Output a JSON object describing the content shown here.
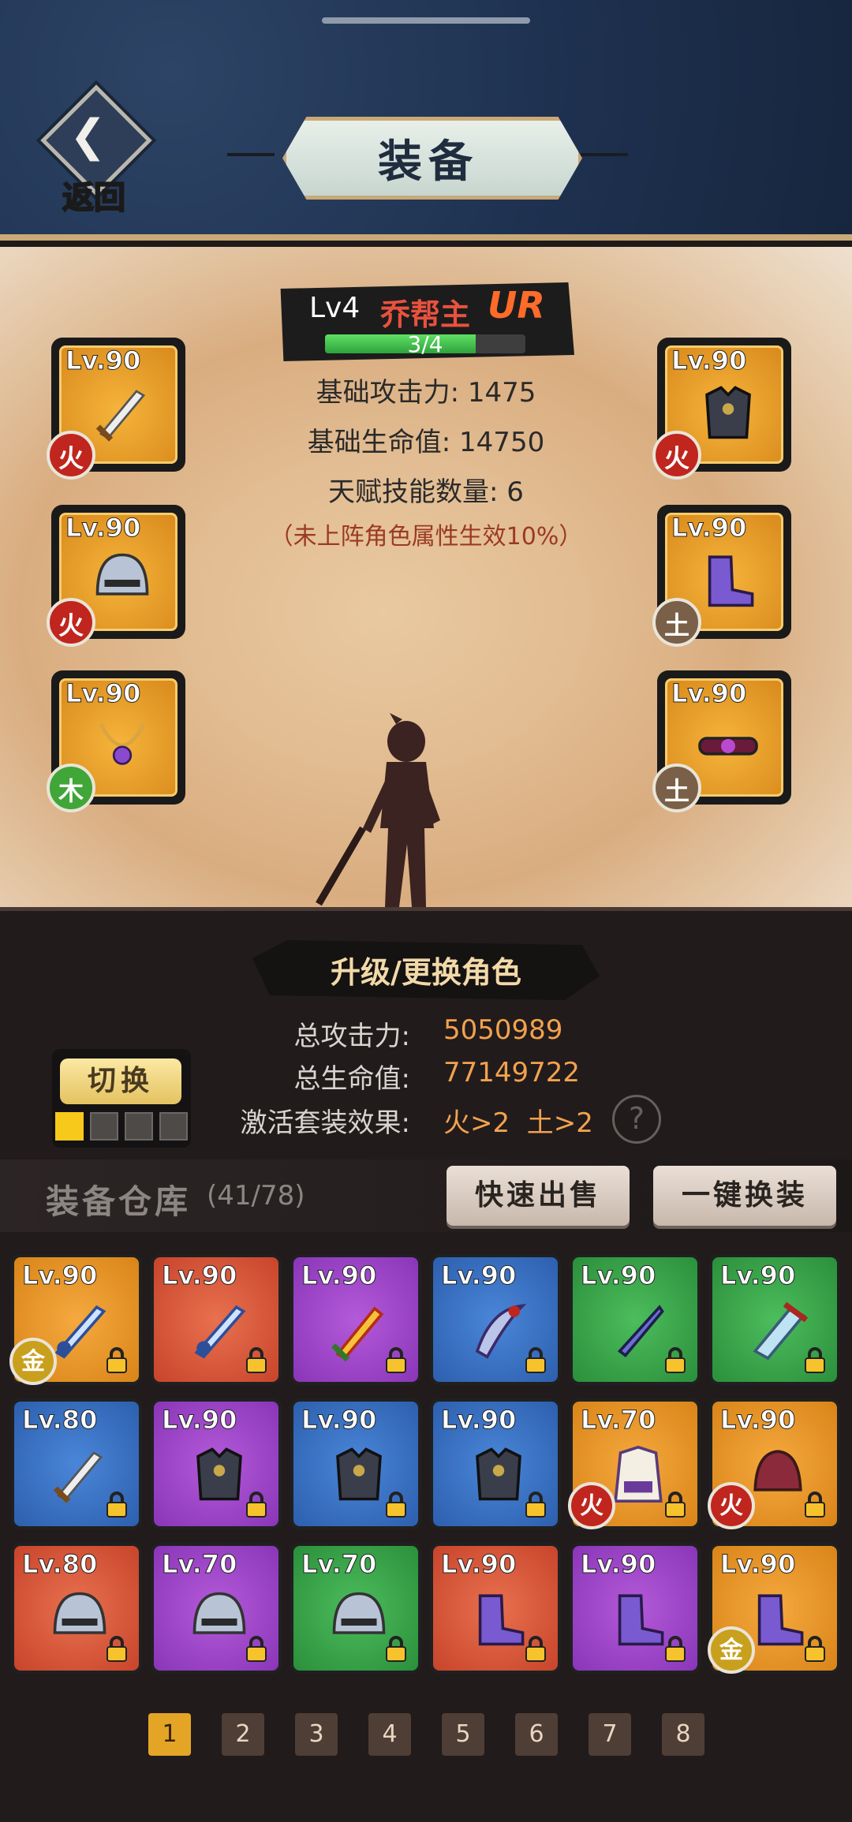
{
  "header": {
    "title": "装备",
    "back_label": "返回"
  },
  "hero": {
    "level": "Lv4",
    "name": "乔帮主",
    "rarity": "UR",
    "progress_text": "3/4",
    "progress": 0.75,
    "stats": [
      "基础攻击力: 1475",
      "基础生命值: 14750",
      "天赋技能数量: 6"
    ],
    "note": "（未上阵角色属性生效10%）"
  },
  "equipped": [
    {
      "level": "Lv.90",
      "element": "火",
      "element_class": "fire",
      "icon": "sword-icon",
      "side": "left"
    },
    {
      "level": "Lv.90",
      "element": "火",
      "element_class": "fire",
      "icon": "helmet-icon",
      "side": "left"
    },
    {
      "level": "Lv.90",
      "element": "木",
      "element_class": "wood",
      "icon": "necklace-icon",
      "side": "left"
    },
    {
      "level": "Lv.90",
      "element": "火",
      "element_class": "fire",
      "icon": "armor-icon",
      "side": "right"
    },
    {
      "level": "Lv.90",
      "element": "土",
      "element_class": "earth",
      "icon": "boots-icon",
      "side": "right"
    },
    {
      "level": "Lv.90",
      "element": "土",
      "element_class": "earth",
      "icon": "belt-icon",
      "side": "right"
    }
  ],
  "upgrade": {
    "label": "升级/更换角色"
  },
  "totals": {
    "attack_label": "总攻击力:",
    "attack_value": "5050989",
    "hp_label": "总生命值:",
    "hp_value": "77149722",
    "set_label": "激活套装效果:",
    "set_value": "火>2  土>2",
    "help": "?"
  },
  "switch": {
    "label": "切换",
    "pages": 4,
    "active_page": 1
  },
  "warehouse": {
    "title": "装备仓库",
    "count": "(41/78)",
    "quick_sell": "快速出售",
    "auto_equip": "一键换装",
    "items": [
      {
        "level": "Lv.90",
        "rarity": "orange",
        "icon": "blue-sword-icon",
        "element": "金",
        "element_class": "gold"
      },
      {
        "level": "Lv.90",
        "rarity": "red",
        "icon": "blue-sword-icon"
      },
      {
        "level": "Lv.90",
        "rarity": "purple",
        "icon": "fire-sword-icon"
      },
      {
        "level": "Lv.90",
        "rarity": "blue",
        "icon": "saber-icon"
      },
      {
        "level": "Lv.90",
        "rarity": "green",
        "icon": "dagger-icon"
      },
      {
        "level": "Lv.90",
        "rarity": "green",
        "icon": "broadsword-icon"
      },
      {
        "level": "Lv.80",
        "rarity": "blue",
        "icon": "sword-icon"
      },
      {
        "level": "Lv.90",
        "rarity": "purple",
        "icon": "armor-icon"
      },
      {
        "level": "Lv.90",
        "rarity": "blue",
        "icon": "armor-icon"
      },
      {
        "level": "Lv.90",
        "rarity": "blue",
        "icon": "armor-icon"
      },
      {
        "level": "Lv.70",
        "rarity": "orange",
        "icon": "robe-icon",
        "element": "火",
        "element_class": "fire"
      },
      {
        "level": "Lv.90",
        "rarity": "orange",
        "icon": "hat-icon",
        "element": "火",
        "element_class": "fire"
      },
      {
        "level": "Lv.80",
        "rarity": "red",
        "icon": "helmet-icon"
      },
      {
        "level": "Lv.70",
        "rarity": "purple",
        "icon": "helmet-icon"
      },
      {
        "level": "Lv.70",
        "rarity": "green",
        "icon": "helmet-icon"
      },
      {
        "level": "Lv.90",
        "rarity": "red",
        "icon": "boots-icon"
      },
      {
        "level": "Lv.90",
        "rarity": "purple",
        "icon": "boots-icon"
      },
      {
        "level": "Lv.90",
        "rarity": "orange",
        "icon": "boots-icon",
        "element": "金",
        "element_class": "gold"
      }
    ]
  },
  "pagination": {
    "pages": [
      "1",
      "2",
      "3",
      "4",
      "5",
      "6",
      "7",
      "8"
    ],
    "active": "1"
  }
}
